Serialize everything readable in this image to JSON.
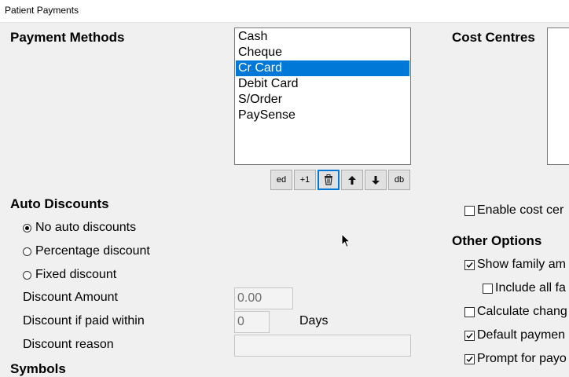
{
  "window": {
    "title": "Patient Payments"
  },
  "payment_methods": {
    "heading": "Payment Methods",
    "items": [
      "Cash",
      "Cheque",
      "Cr Card",
      "Debit Card",
      "S/Order",
      "PaySense"
    ],
    "selected": "Cr Card",
    "toolbar": {
      "edit_label": "ed",
      "add_label": "+1",
      "db_label": "db"
    }
  },
  "auto_discounts": {
    "heading": "Auto Discounts",
    "options": [
      "No auto discounts",
      "Percentage discount",
      "Fixed discount"
    ],
    "selected": "No auto discounts",
    "discount_amount_label": "Discount Amount",
    "discount_amount_value": "0.00",
    "paid_within_label": "Discount if paid within",
    "paid_within_value": "0",
    "days_label": "Days",
    "reason_label": "Discount reason",
    "reason_value": "",
    "next_heading_partial": "Symbols"
  },
  "cost_centres": {
    "heading": "Cost Centres",
    "enable_label": "Enable cost cer",
    "enable_checked": false
  },
  "other_options": {
    "heading": "Other Options",
    "items": [
      {
        "label": "Show family am",
        "checked": true
      },
      {
        "label": "Include all fa",
        "checked": false
      },
      {
        "label": "Calculate chang",
        "checked": false
      },
      {
        "label": "Default paymen",
        "checked": true
      },
      {
        "label": "Prompt for payo",
        "checked": true
      }
    ]
  }
}
